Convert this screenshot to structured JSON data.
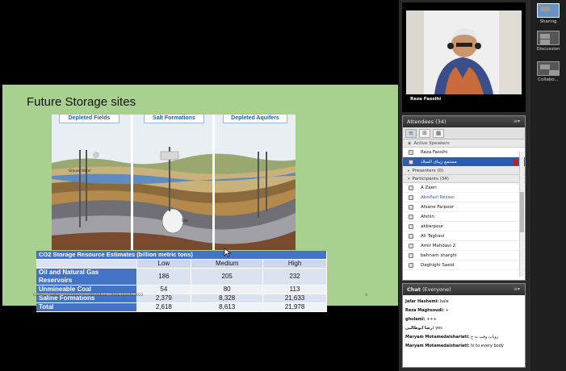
{
  "slide": {
    "title": "Future Storage sites",
    "illustration_labels": [
      "Depleted Fields",
      "Salt Formations",
      "Depleted Aquifers"
    ],
    "salt_text": "Salt",
    "groundwater_text": "Ground Water",
    "table_caption": "CO2 Storage Resource Estimates (billion metric tons)",
    "columns": [
      "Low",
      "Medium",
      "High"
    ],
    "rows": [
      {
        "label": "Oil and Natural Gas Reservoirs",
        "values": [
          "186",
          "205",
          "232"
        ]
      },
      {
        "label": "Unmineable Coal",
        "values": [
          "54",
          "80",
          "113"
        ]
      },
      {
        "label": "Saline Formations",
        "values": [
          "2,379",
          "8,328",
          "21,633"
        ]
      },
      {
        "label": "Total",
        "values": [
          "2,618",
          "8,613",
          "21,978"
        ]
      }
    ],
    "footer": "Carbon Capture and Storage / Utilization – Reza Fassihi 2022",
    "page_number": "4"
  },
  "video": {
    "name": "Reza Fassihi"
  },
  "attendees": {
    "title": "Attendees",
    "count": "(34)",
    "menu": "≡▾",
    "active_speakers_label": "Active Speakers",
    "speakers": [
      "Reza Fassihi",
      "مستمع زيباى السلاد"
    ],
    "presenters_label": "Presenters (0)",
    "participants_label": "Participants (34)",
    "participants": [
      "A Zaeri",
      "Abolfazl Rezaei",
      "Afsane Farpoor",
      "Afshin",
      "akbarpour",
      "Ali Taghavi",
      "Amir Mahdavi 2",
      "behnam sharghi",
      "Daghighi Saeid"
    ]
  },
  "chat": {
    "title": "Chat",
    "scope": "(Everyone)",
    "messages": [
      {
        "from": "Jafar Hashemi:",
        "text": "bale"
      },
      {
        "from": "Reza Maghsoudi:",
        "text": "+"
      },
      {
        "from": "gholami:",
        "text": "+++"
      },
      {
        "from": "رضا ابوطالبی:",
        "text": "yes"
      },
      {
        "from": "Maryam Motamedalshariati:",
        "text": "رویاب وقت به خ"
      },
      {
        "from": "Maryam Motamedalshariati:",
        "text": "hi to every body"
      }
    ]
  },
  "pods": [
    {
      "label": "Sharing",
      "active": true
    },
    {
      "label": "Discussion",
      "active": false
    },
    {
      "label": "Collabo...",
      "active": false
    }
  ]
}
